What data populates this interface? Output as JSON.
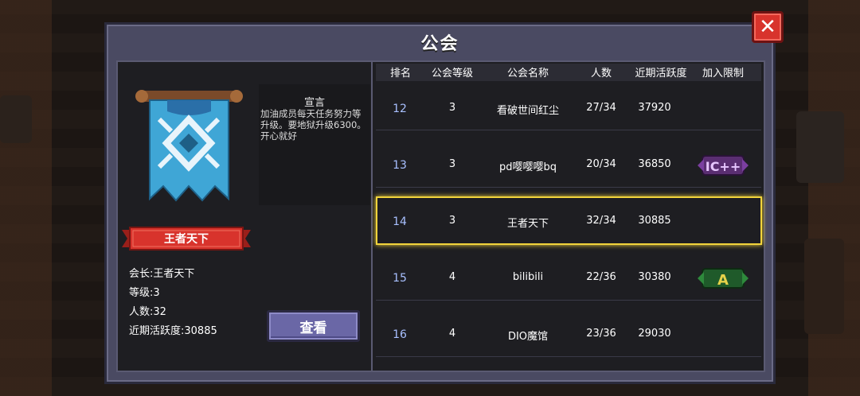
{
  "window": {
    "title": "公会",
    "close_glyph": "✕"
  },
  "guild": {
    "declaration_title": "宣言",
    "declaration_text": "加油成员每天任务努力等升级。要地狱升级6300。开心就好",
    "name": "王者天下",
    "leader": "会长:王者天下",
    "level": "等级:3",
    "members": "人数:32",
    "activity": "近期活跃度:30885",
    "view_button": "查看"
  },
  "table": {
    "headers": [
      "排名",
      "公会等级",
      "公会名称",
      "人数",
      "近期活跃度",
      "加入限制"
    ],
    "rows": [
      {
        "rank": "12",
        "level": "3",
        "name": "看破世间红尘",
        "members": "27/34",
        "activity": "37920",
        "restriction": ""
      },
      {
        "rank": "13",
        "level": "3",
        "name": "pd嘤嘤嘤bq",
        "members": "20/34",
        "activity": "36850",
        "restriction": "IC++"
      },
      {
        "rank": "14",
        "level": "3",
        "name": "王者天下",
        "members": "32/34",
        "activity": "30885",
        "restriction": ""
      },
      {
        "rank": "15",
        "level": "4",
        "name": "bilibili",
        "members": "22/36",
        "activity": "30380",
        "restriction": "A"
      },
      {
        "rank": "16",
        "level": "4",
        "name": "DIO魔馆",
        "members": "23/36",
        "activity": "29030",
        "restriction": ""
      }
    ],
    "selected_rank": "14"
  },
  "colors": {
    "panel": "#4a4a62",
    "highlight": "#f2d43c",
    "close": "#d8332c",
    "button": "#6a67a6",
    "banner": "#3fa6d6",
    "ribbon": "#d8332c"
  },
  "icons": [
    "close-icon",
    "guild-banner-icon",
    "restriction-badge-icon"
  ]
}
